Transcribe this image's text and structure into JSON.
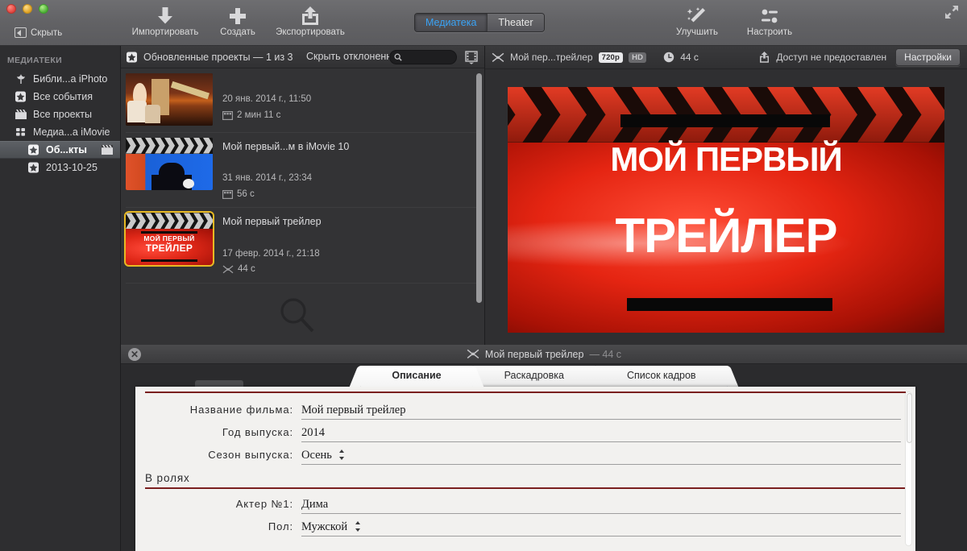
{
  "toolbar": {
    "hide_label": "Скрыть",
    "import_label": "Импортировать",
    "create_label": "Создать",
    "export_label": "Экспортировать",
    "enhance_label": "Улучшить",
    "adjust_label": "Настроить",
    "segments": [
      {
        "label": "Медиатека",
        "active": true
      },
      {
        "label": "Theater",
        "active": false
      }
    ],
    "accent_blue": "#3aa3f5"
  },
  "sidebar": {
    "section_title": "МЕДИАТЕКИ",
    "items": [
      {
        "label": "Библи...а iPhoto",
        "icon": "iphoto-icon",
        "selected": false,
        "indent": false
      },
      {
        "label": "Все события",
        "icon": "star-icon",
        "selected": false,
        "indent": false
      },
      {
        "label": "Все проекты",
        "icon": "clapper-icon",
        "selected": false,
        "indent": false
      },
      {
        "label": "Медиа...а iMovie",
        "icon": "grid-icon",
        "selected": false,
        "indent": false,
        "twisty": "open"
      },
      {
        "label": "Об...кты",
        "icon": "star-icon",
        "selected": true,
        "indent": true,
        "trailing_icon": "clapper-icon"
      },
      {
        "label": "2013-10-25",
        "icon": "star-icon",
        "selected": false,
        "indent": true
      }
    ]
  },
  "browser": {
    "header_title": "Обновленные проекты — 1 из 3",
    "filter_label": "Скрыть отклоненные",
    "search_placeholder": "",
    "search_value": "",
    "projects": [
      {
        "name": "",
        "date": "20 янв. 2014 г., 11:50",
        "duration": "2 мин 11 с",
        "duration_icon": "filmstrip-icon",
        "selected": false,
        "art": "concert"
      },
      {
        "name": "Мой первый...м в iMovie 10",
        "date": "31 янв. 2014 г., 23:34",
        "duration": "56 с",
        "duration_icon": "filmstrip-icon",
        "selected": false,
        "art": "blue-trailer"
      },
      {
        "name": "Мой первый трейлер",
        "date": "17 февр. 2014 г., 21:18",
        "duration": "44 с",
        "duration_icon": "trailer-icon",
        "selected": true,
        "art": "red-trailer",
        "thumb_line1": "МОЙ ПЕРВЫЙ",
        "thumb_line2": "ТРЕЙЛЕР"
      }
    ]
  },
  "viewer": {
    "title": "Мой пер...трейлер",
    "badge_resolution": "720p",
    "badge_quality": "HD",
    "duration": "44 с",
    "share_status": "Доступ не предоставлен",
    "settings_label": "Настройки",
    "stage_line1": "МОЙ ПЕРВЫЙ",
    "stage_line2": "ТРЕЙЛЕР"
  },
  "bottom": {
    "header_title": "Мой первый трейлер",
    "header_duration": "— 44 с",
    "tabs": [
      {
        "label": "Описание",
        "active": true
      },
      {
        "label": "Раскадровка",
        "active": false
      },
      {
        "label": "Список кадров",
        "active": false
      }
    ],
    "form": {
      "fields": [
        {
          "label": "Название фильма:",
          "value": "Мой первый трейлер",
          "stepper": false
        },
        {
          "label": "Год выпуска:",
          "value": "2014",
          "stepper": false
        },
        {
          "label": "Сезон выпуска:",
          "value": "Осень",
          "stepper": true
        }
      ],
      "section_title": "В ролях",
      "cast_fields": [
        {
          "label": "Актер №1:",
          "value": "Дима",
          "stepper": false
        },
        {
          "label": "Пол:",
          "value": "Мужской",
          "stepper": true
        }
      ],
      "rule_color": "#7a1f1f"
    }
  }
}
